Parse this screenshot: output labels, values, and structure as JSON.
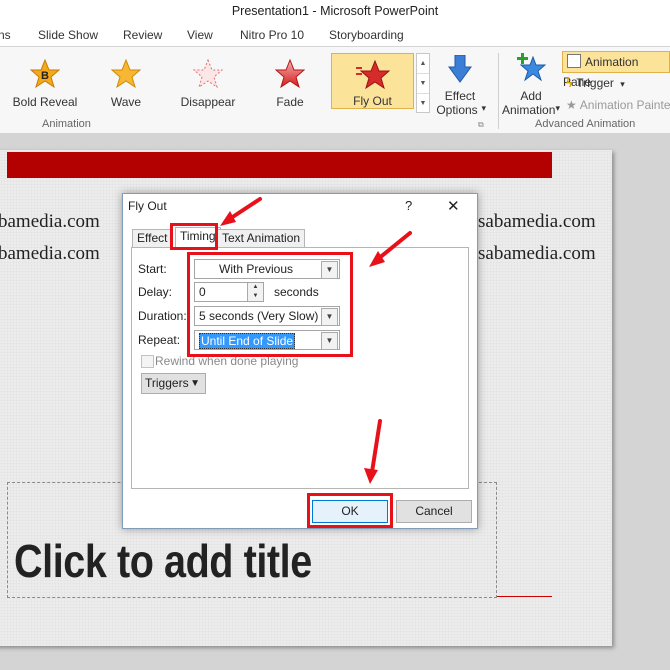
{
  "window": {
    "title": "Presentation1 - Microsoft PowerPoint"
  },
  "tabs": [
    "ns",
    "Slide Show",
    "Review",
    "View",
    "Nitro Pro 10",
    "Storyboarding"
  ],
  "ribbon": {
    "animations": [
      {
        "label": "Bold Reveal",
        "icon": "bold-reveal-star-icon"
      },
      {
        "label": "Wave",
        "icon": "wave-star-icon"
      },
      {
        "label": "Disappear",
        "icon": "disappear-star-icon"
      },
      {
        "label": "Fade",
        "icon": "fade-star-icon"
      },
      {
        "label": "Fly Out",
        "icon": "fly-out-star-icon"
      }
    ],
    "effect_options": {
      "line1": "Effect",
      "line2": "Options",
      "caret": "▾"
    },
    "add_animation": {
      "line1": "Add",
      "line2": "Animation",
      "caret": "▾"
    },
    "animation_pane": "Animation Pane",
    "trigger": "Trigger",
    "trigger_caret": "▾",
    "animation_painter": "Animation Painter",
    "group_animation": "Animation",
    "group_advanced": "Advanced Animation",
    "colors": {
      "selected": "#fbe39a"
    }
  },
  "slide": {
    "watermark_left": [
      "bamedia.com",
      "bamedia.com"
    ],
    "watermark_right": [
      "sabamedia.com",
      "sabamedia.com"
    ],
    "title_placeholder": "Click to add title",
    "bar_color": "#b30000"
  },
  "dialog": {
    "title": "Fly Out",
    "help": "?",
    "close": "✕",
    "tabs": [
      "Effect",
      "Timing",
      "Text Animation"
    ],
    "start_label": "Start:",
    "start_value": "With Previous",
    "delay_label": "Delay:",
    "delay_value": "0",
    "delay_unit": "seconds",
    "duration_label": "Duration:",
    "duration_value": "5 seconds (Very Slow)",
    "repeat_label": "Repeat:",
    "repeat_value": "Until End of Slide",
    "rewind_label": "Rewind when done playing",
    "triggers_label": "Triggers",
    "ok_label": "OK",
    "cancel_label": "Cancel"
  },
  "annotation_color": "#e8111a"
}
